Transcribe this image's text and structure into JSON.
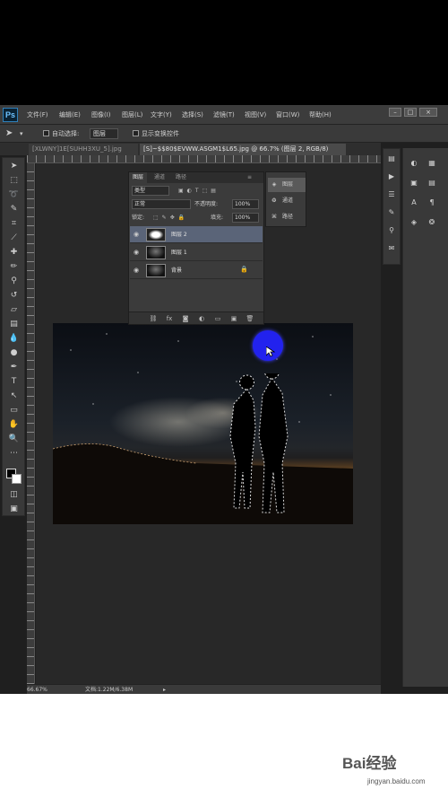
{
  "app": {
    "logo": "Ps"
  },
  "menu": [
    {
      "label": "文件(F)"
    },
    {
      "label": "编辑(E)"
    },
    {
      "label": "图像(I)"
    },
    {
      "label": "图层(L)"
    },
    {
      "label": "文字(Y)"
    },
    {
      "label": "选择(S)"
    },
    {
      "label": "滤镜(T)"
    },
    {
      "label": "视图(V)"
    },
    {
      "label": "窗口(W)"
    },
    {
      "label": "帮助(H)"
    }
  ],
  "options": {
    "auto_select_label": "自动选择:",
    "auto_select_value": "图层",
    "show_transform_label": "显示变换控件"
  },
  "tabs": [
    {
      "label": "[XLWNY]1E[SUHH3XU_5].jpg"
    },
    {
      "label": "[S]~$$80$EVWW.ASGM1$L65.jpg @ 66.7% (图层 2, RGB/8)"
    }
  ],
  "layers_panel": {
    "tabs": [
      "图层",
      "通道",
      "路径"
    ],
    "kind_label": "类型",
    "blend_mode": "正常",
    "opacity_label": "不透明度:",
    "opacity_value": "100%",
    "lock_label": "锁定:",
    "fill_label": "填充:",
    "fill_value": "100%",
    "layers": [
      {
        "name": "图层 2",
        "selected": true
      },
      {
        "name": "图层 1",
        "selected": false
      },
      {
        "name": "背景",
        "selected": false
      }
    ]
  },
  "mini_panel": {
    "items": [
      {
        "label": "图层",
        "icon": "layers-icon"
      },
      {
        "label": "通道",
        "icon": "channels-icon"
      },
      {
        "label": "路径",
        "icon": "paths-icon"
      }
    ]
  },
  "status": {
    "zoom": "66.67%",
    "doc": "文档:1.22M/6.38M"
  },
  "watermark": {
    "logo_text": "Bai经验",
    "url": "jingyan.baidu.com"
  },
  "colors": {
    "foreground": "#000000",
    "background": "#ffffff",
    "cursor_highlight": "#2222ee",
    "selected_layer": "#5a6478"
  }
}
